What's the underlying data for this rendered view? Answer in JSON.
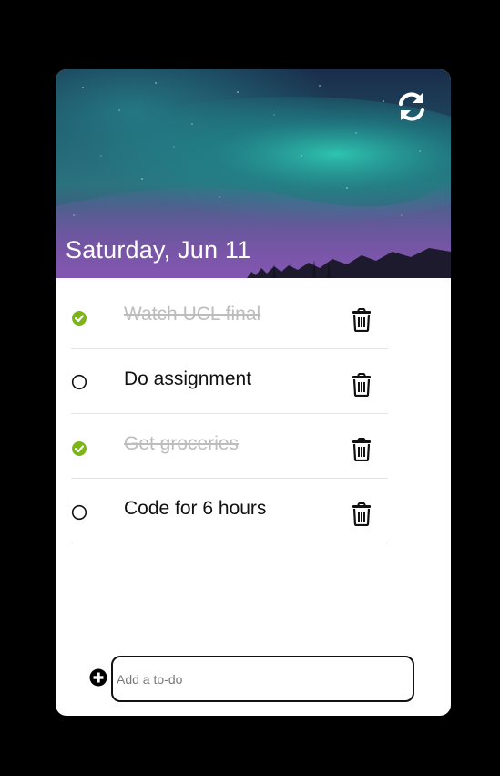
{
  "header": {
    "date": "Saturday, Jun 11",
    "refresh_icon": "refresh-icon"
  },
  "todos": [
    {
      "label": "Watch UCL final",
      "done": true
    },
    {
      "label": "Do assignment",
      "done": false
    },
    {
      "label": "Get groceries",
      "done": true
    },
    {
      "label": "Code for 6 hours",
      "done": false
    }
  ],
  "add_form": {
    "placeholder": "Add a to-do",
    "value": "",
    "icon": "plus-circle-icon"
  },
  "colors": {
    "check_done": "#7cb518",
    "background": "#000000",
    "card": "#ffffff",
    "done_text": "#bdbdbd"
  }
}
